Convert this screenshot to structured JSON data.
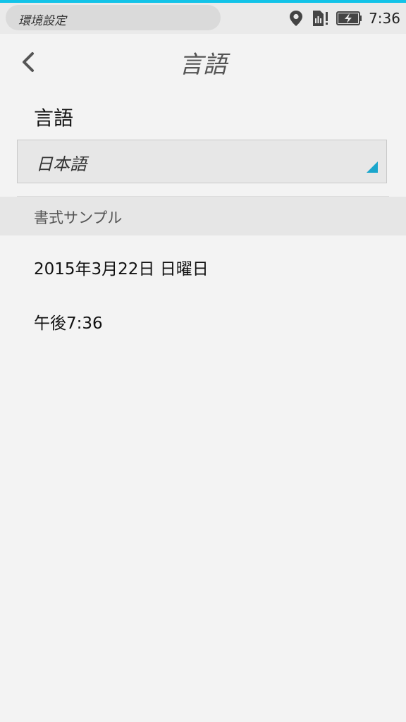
{
  "status_bar": {
    "app_name": "環境設定",
    "time": "7:36",
    "icons": [
      "location-icon",
      "sim-icon",
      "battery-charging-icon"
    ]
  },
  "header": {
    "title": "言語",
    "back_icon": "chevron-left-icon"
  },
  "language_section": {
    "label": "言語",
    "selected_language": "日本語"
  },
  "format_sample": {
    "header": "書式サンプル",
    "date": "2015年3月22日 日曜日",
    "time": "午後7:36"
  },
  "colors": {
    "accent": "#12c3e8",
    "background": "#f3f3f3",
    "section_header_bg": "#e6e6e6",
    "dropdown_arrow": "#1aa6cc"
  }
}
